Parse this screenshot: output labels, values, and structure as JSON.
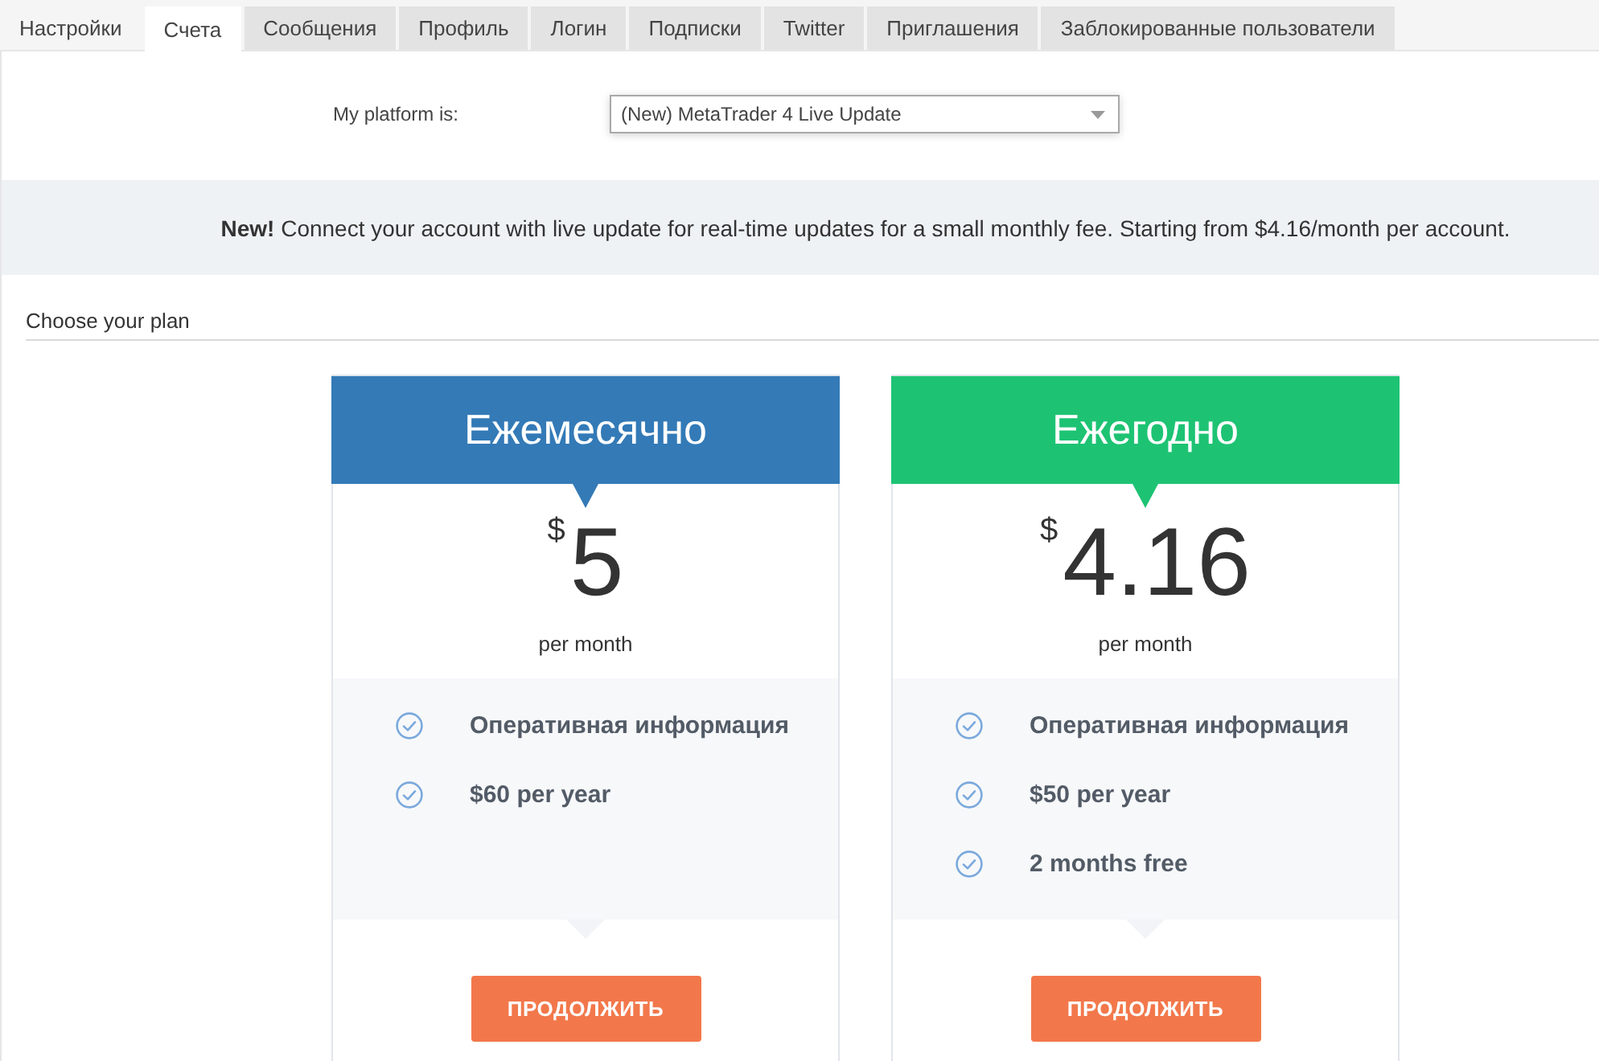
{
  "tabs": [
    {
      "label": "Настройки",
      "kind": "link",
      "selected": false
    },
    {
      "label": "Счета",
      "kind": "tab",
      "selected": true
    },
    {
      "label": "Сообщения",
      "kind": "tab",
      "selected": false
    },
    {
      "label": "Профиль",
      "kind": "tab",
      "selected": false
    },
    {
      "label": "Логин",
      "kind": "tab",
      "selected": false
    },
    {
      "label": "Подписки",
      "kind": "tab",
      "selected": false
    },
    {
      "label": "Twitter",
      "kind": "tab",
      "selected": false
    },
    {
      "label": "Приглашения",
      "kind": "tab",
      "selected": false
    },
    {
      "label": "Заблокированные пользователи",
      "kind": "tab",
      "selected": false
    }
  ],
  "platform": {
    "label": "My platform is:",
    "value": "(New) MetaTrader 4 Live Update"
  },
  "notice": {
    "text": "**New!** Connect your account with live update for real-time updates for a small monthly fee. Starting from $4.16/month per account."
  },
  "plans_heading": "Choose your plan",
  "plans": [
    {
      "title": "Ежемесячно",
      "color": "#337ab7",
      "currency": "$",
      "amount": "5",
      "period": "per month",
      "features": [
        "Оперативная информация",
        "$60 per year"
      ],
      "button": "ПРОДОЛЖИТЬ"
    },
    {
      "title": "Ежегодно",
      "color": "#1dc373",
      "currency": "$",
      "amount": "4.16",
      "period": "per month",
      "features": [
        "Оперативная информация",
        "$50 per year",
        "2 months free"
      ],
      "button": "ПРОДОЛЖИТЬ"
    }
  ]
}
